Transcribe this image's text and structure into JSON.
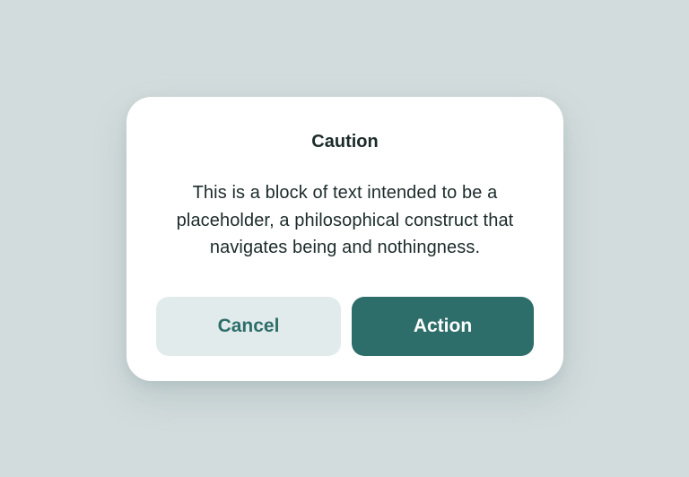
{
  "dialog": {
    "title": "Caution",
    "body": "This is a block of text intended to be a placeholder, a philosophical construct that navigates being and nothingness.",
    "cancel_label": "Cancel",
    "action_label": "Action"
  },
  "colors": {
    "background": "#d3dcdd",
    "card": "#ffffff",
    "primary": "#2e6e6a",
    "secondary_bg": "#e2ebec",
    "text": "#1c2b2a"
  }
}
